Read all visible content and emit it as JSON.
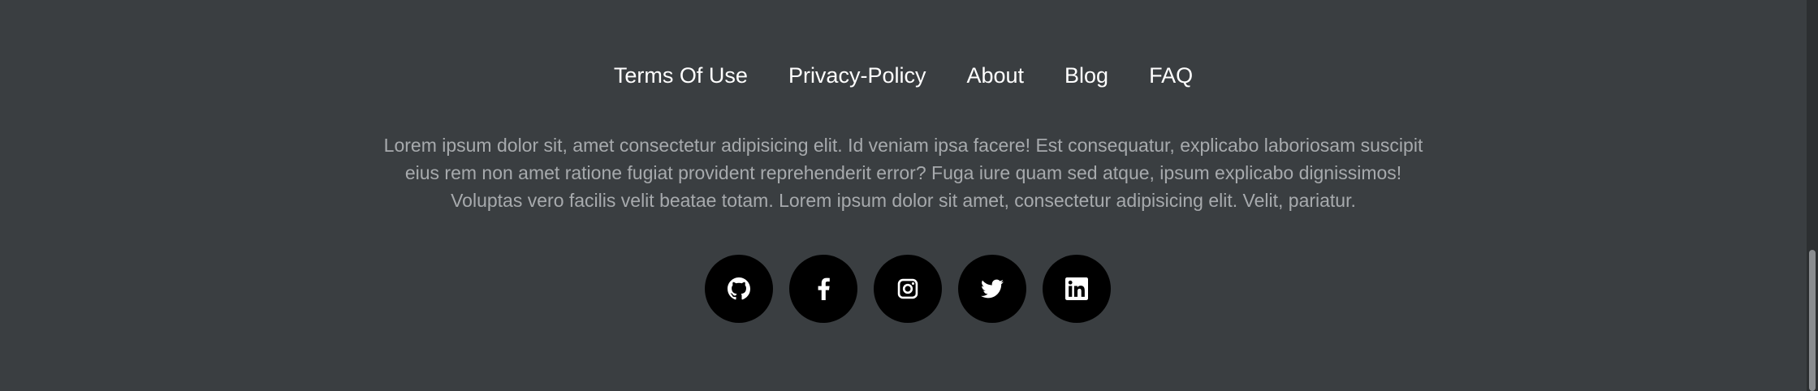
{
  "nav": {
    "links": [
      {
        "label": "Terms Of Use"
      },
      {
        "label": "Privacy-Policy"
      },
      {
        "label": "About"
      },
      {
        "label": "Blog"
      },
      {
        "label": "FAQ"
      }
    ]
  },
  "description": {
    "lines": [
      "Lorem ipsum dolor sit, amet consectetur adipisicing elit. Id veniam ipsa facere! Est consequatur, explicabo laboriosam suscipit",
      "eius rem non amet ratione fugiat provident reprehenderit error? Fuga iure quam sed atque, ipsum explicabo dignissimos!",
      "Voluptas vero facilis velit beatae totam. Lorem ipsum dolor sit amet, consectetur adipisicing elit. Velit, pariatur."
    ]
  },
  "socials": [
    {
      "icon": "github-icon"
    },
    {
      "icon": "facebook-icon"
    },
    {
      "icon": "instagram-icon"
    },
    {
      "icon": "twitter-icon"
    },
    {
      "icon": "linkedin-icon"
    }
  ],
  "colors": {
    "background": "#3a3e41",
    "link": "#ffffff",
    "text": "#a7aaad",
    "social_bg": "#000000"
  }
}
